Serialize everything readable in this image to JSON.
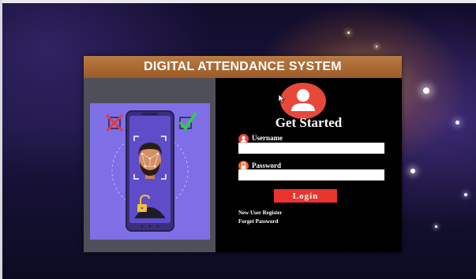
{
  "app": {
    "title": "DIGITAL ATTENDANCE SYSTEM"
  },
  "illustration": {
    "description_icons": [
      "rejected-cross-icon",
      "approved-check-icon",
      "face-scan-icon",
      "unlock-icon"
    ]
  },
  "login": {
    "heading": "Get Started",
    "username_label": "Username",
    "username_value": "",
    "password_label": "Password",
    "password_value": "",
    "login_button": "Login",
    "register_link": "New User Register",
    "forgot_link": "Forget Password"
  },
  "colors": {
    "title_bar": "#a8662f",
    "accent_red": "#e8483c",
    "login_button": "#e8342c",
    "illustration_bg": "#7f6fe6",
    "panel_bg": "#000000"
  }
}
